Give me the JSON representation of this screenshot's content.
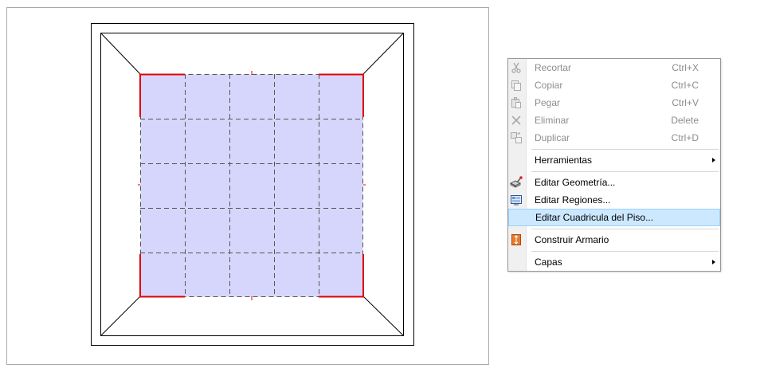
{
  "context_menu": {
    "items": [
      {
        "label": "Recortar",
        "shortcut": "Ctrl+X",
        "icon": "scissors-icon",
        "disabled": true
      },
      {
        "label": "Copiar",
        "shortcut": "Ctrl+C",
        "icon": "copy-icon",
        "disabled": true
      },
      {
        "label": "Pegar",
        "shortcut": "Ctrl+V",
        "icon": "paste-icon",
        "disabled": true
      },
      {
        "label": "Eliminar",
        "shortcut": "Delete",
        "icon": "delete-x-icon",
        "disabled": true
      },
      {
        "label": "Duplicar",
        "shortcut": "Ctrl+D",
        "icon": "duplicate-icon",
        "disabled": true
      },
      {
        "label": "Herramientas",
        "submenu": true
      },
      {
        "label": "Editar Geometría...",
        "icon": "geometry-edit-icon"
      },
      {
        "label": "Editar Regiones...",
        "icon": "regions-edit-icon"
      },
      {
        "label": "Editar Cuadricula del Piso...",
        "highlighted": true
      },
      {
        "label": "Construir Armario",
        "icon": "build-cabinet-icon"
      },
      {
        "label": "Capas",
        "submenu": true
      }
    ]
  },
  "colors": {
    "floor_fill": "#d6d6fc",
    "edge_highlight": "#e00000",
    "menu_highlight": "#cce8ff",
    "menu_highlight_border": "#99d1ff",
    "disabled_text": "#8d8d8d"
  }
}
